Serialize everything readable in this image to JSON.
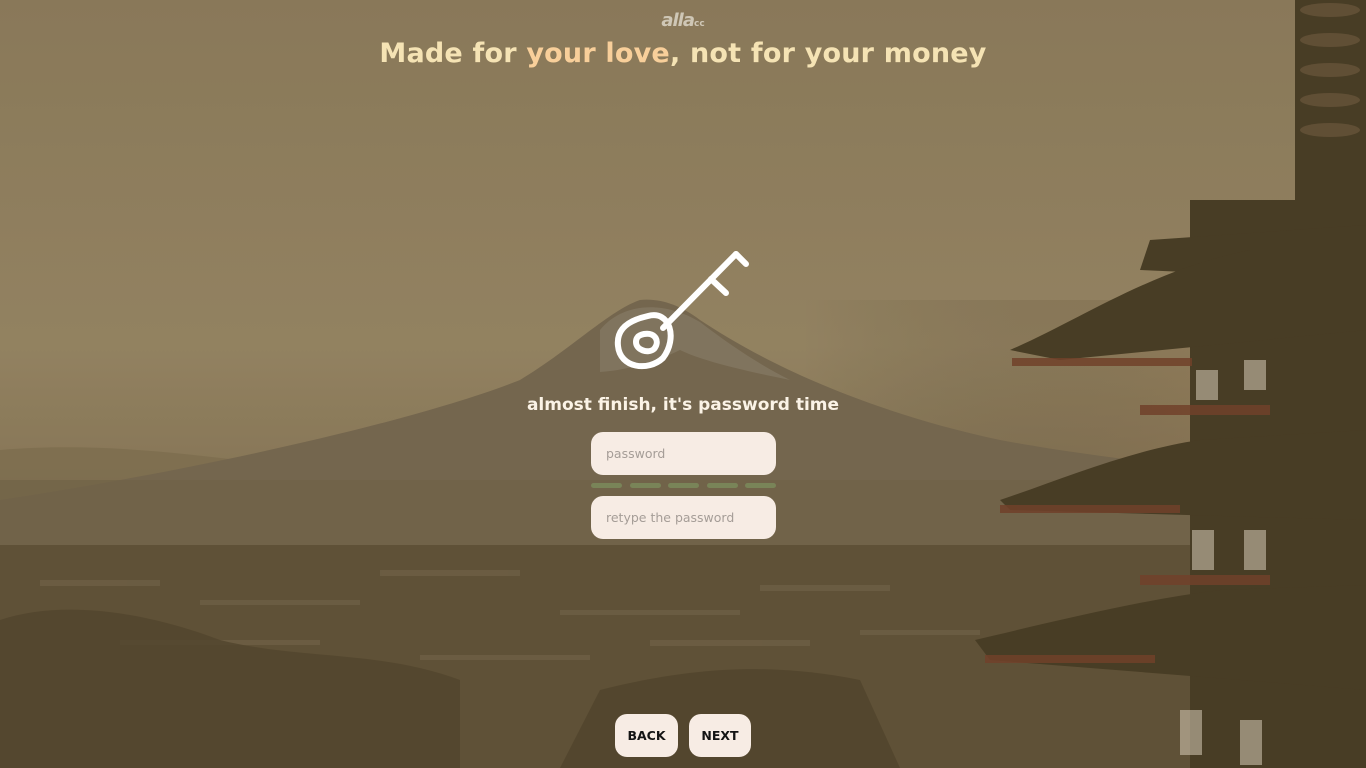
{
  "brand": {
    "logo_main": "alla",
    "logo_sub": "cc"
  },
  "headline": {
    "part1": "Made for ",
    "accent": "your love",
    "part2": ", not for your money"
  },
  "step": {
    "icon": "key-icon",
    "prompt": "almost finish, it's password time"
  },
  "form": {
    "password_placeholder": "password",
    "password_value": "",
    "retype_placeholder": "retype the password",
    "retype_value": "",
    "strength_segments": 5
  },
  "nav": {
    "back_label": "BACK",
    "next_label": "NEXT"
  },
  "colors": {
    "headline": "#f5e3b4",
    "accent": "#f8cf9a",
    "field_bg": "#f7ece4",
    "strength": "#7a8a5a"
  }
}
